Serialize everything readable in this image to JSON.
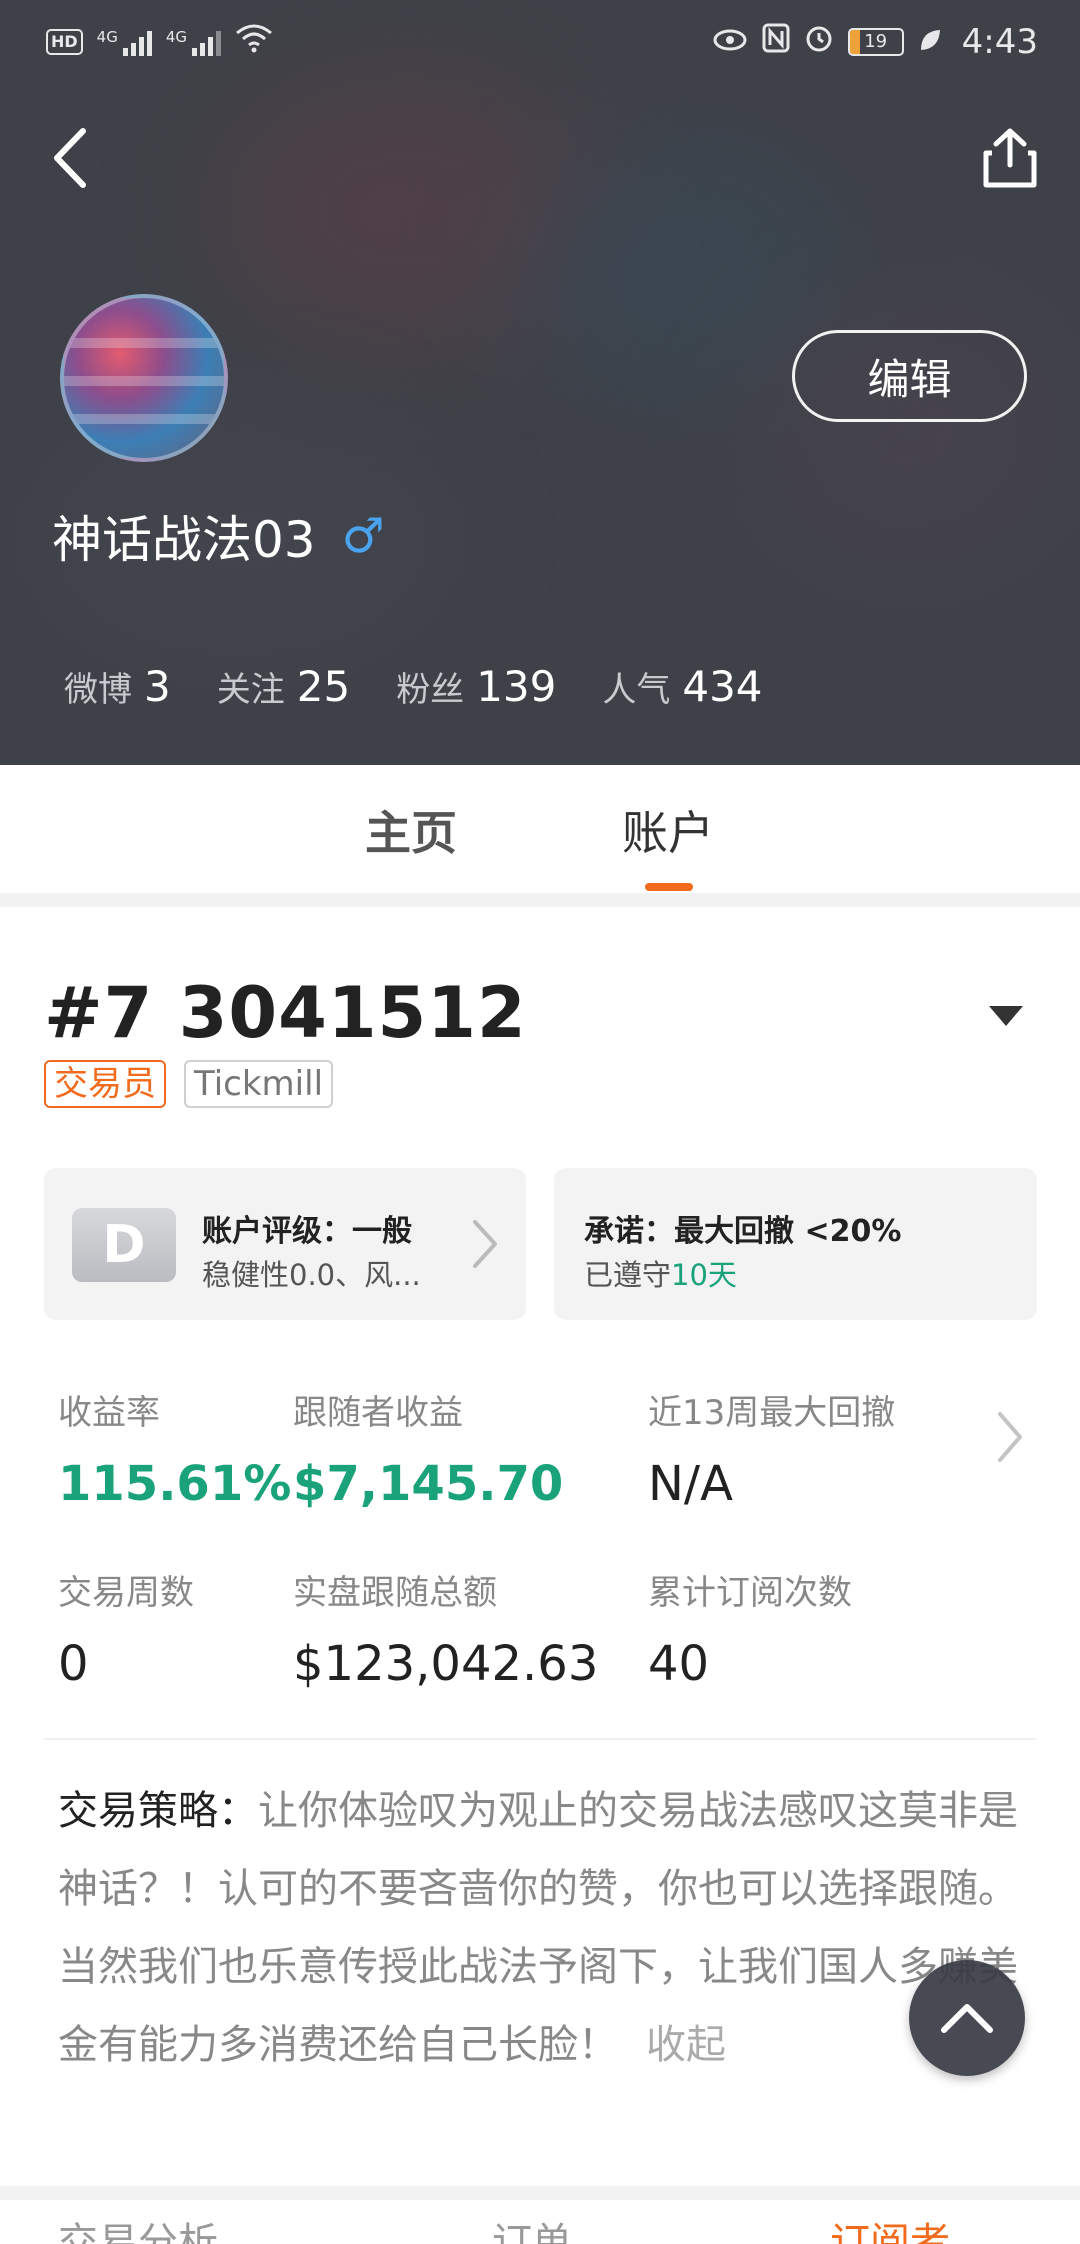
{
  "status_bar": {
    "left_badges": [
      "HD",
      "4G",
      "4G"
    ],
    "battery": "19",
    "time": "4:43"
  },
  "profile": {
    "username": "神话战法03",
    "gender_symbol": "♂",
    "edit_label": "编辑",
    "stats": [
      {
        "label": "微博",
        "value": "3"
      },
      {
        "label": "关注",
        "value": "25"
      },
      {
        "label": "粉丝",
        "value": "139"
      },
      {
        "label": "人气",
        "value": "434"
      }
    ]
  },
  "tabs": {
    "home": "主页",
    "account": "账户",
    "active": "account"
  },
  "account": {
    "id": "#7 3041512",
    "tags": [
      "交易员",
      "Tickmill"
    ],
    "rating": {
      "grade": "D",
      "title": "账户评级：一般",
      "subtitle": "稳健性0.0、风..."
    },
    "promise": {
      "title": "承诺：最大回撤 <20%",
      "subtitle_prefix": "已遵守",
      "subtitle_days": "10天"
    },
    "metrics": [
      {
        "label": "收益率",
        "value": "115.61%",
        "highlight": true
      },
      {
        "label": "跟随者收益",
        "value": "$7,145.70",
        "highlight": true
      },
      {
        "label": "近13周最大回撤",
        "value": "N/A",
        "highlight": false
      },
      {
        "label": "交易周数",
        "value": "0",
        "highlight": false
      },
      {
        "label": "实盘跟随总额",
        "value": "$123,042.63",
        "highlight": false
      },
      {
        "label": "累计订阅次数",
        "value": "40",
        "highlight": false
      }
    ],
    "strategy": {
      "label": "交易策略：",
      "text": "让你体验叹为观止的交易战法感叹这莫非是神话？！认可的不要吝啬你的赞，你也可以选择跟随。当然我们也乐意传授此战法予阁下，让我们国人多赚美金有能力多消费还给自己长脸！",
      "collapse_label": "收起"
    }
  },
  "bottom_tabs": [
    "交易分析",
    "订单",
    "订阅者"
  ],
  "colors": {
    "accent": "#f26a1b",
    "positive": "#1aa37a",
    "gender": "#4aa3ef"
  }
}
